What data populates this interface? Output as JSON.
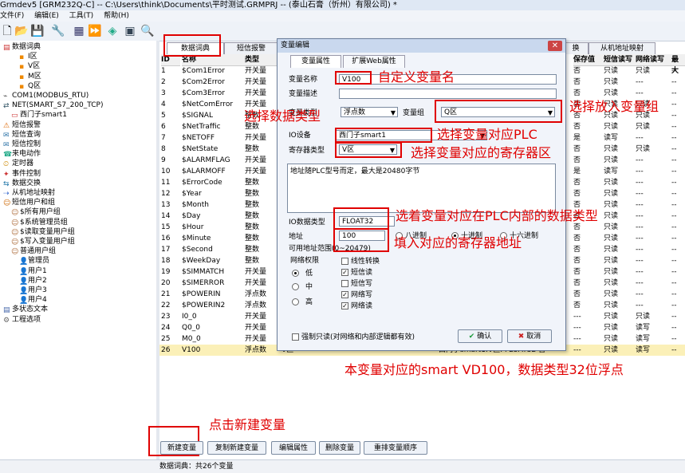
{
  "window": {
    "title": "Grmdev5 [GRM232Q-C] -- C:\\Users\\think\\Documents\\平时测试.GRMPRJ -- (泰山石膏（忻州）有限公司) *"
  },
  "menu": [
    "文件(F)",
    "编辑(E)",
    "工具(T)",
    "帮助(H)"
  ],
  "tree": [
    {
      "label": "数据词典",
      "indent": 0
    },
    {
      "label": "I区",
      "indent": 2
    },
    {
      "label": "V区",
      "indent": 2
    },
    {
      "label": "M区",
      "indent": 2
    },
    {
      "label": "Q区",
      "indent": 2
    },
    {
      "label": "COM1(MODBUS_RTU)",
      "indent": 0
    },
    {
      "label": "NET(SMART_S7_200_TCP)",
      "indent": 0
    },
    {
      "label": "西门子smart1",
      "indent": 1
    },
    {
      "label": "短信报警",
      "indent": 0
    },
    {
      "label": "短信查询",
      "indent": 0
    },
    {
      "label": "短信控制",
      "indent": 0
    },
    {
      "label": "来电动作",
      "indent": 0
    },
    {
      "label": "定时器",
      "indent": 0
    },
    {
      "label": "事件控制",
      "indent": 0
    },
    {
      "label": "数据交换",
      "indent": 0
    },
    {
      "label": "从机地址映射",
      "indent": 0
    },
    {
      "label": "短信用户和组",
      "indent": 0
    },
    {
      "label": "$所有用户组",
      "indent": 1
    },
    {
      "label": "$系统管理员组",
      "indent": 1
    },
    {
      "label": "$读取变量用户组",
      "indent": 1
    },
    {
      "label": "$写入变量用户组",
      "indent": 1
    },
    {
      "label": "普通用户组",
      "indent": 1
    },
    {
      "label": "管理员",
      "indent": 2
    },
    {
      "label": "用户1",
      "indent": 2
    },
    {
      "label": "用户2",
      "indent": 2
    },
    {
      "label": "用户3",
      "indent": 2
    },
    {
      "label": "用户4",
      "indent": 2
    },
    {
      "label": "多状态文本",
      "indent": 0
    },
    {
      "label": "工程选项",
      "indent": 0
    }
  ],
  "tabs": {
    "t1": "数据词典",
    "t2": "短信报警",
    "t3": "换",
    "t4": "从机地址映射"
  },
  "table": {
    "headers": [
      "ID",
      "名称",
      "类型",
      "保存值",
      "短信读写",
      "网络读写",
      "最大"
    ],
    "rows": [
      [
        "1",
        "$Com1Error",
        "开关量",
        "否",
        "只读",
        "只读",
        "--"
      ],
      [
        "2",
        "$Com2Error",
        "开关量",
        "否",
        "只读",
        "---",
        "--"
      ],
      [
        "3",
        "$Com3Error",
        "开关量",
        "否",
        "只读",
        "---",
        "--"
      ],
      [
        "4",
        "$NetComError",
        "开关量",
        "否",
        "只读",
        "只读",
        "--"
      ],
      [
        "5",
        "$SIGNAL",
        "整数",
        "否",
        "只读",
        "只读",
        "--"
      ],
      [
        "6",
        "$NetTraffic",
        "整数",
        "否",
        "只读",
        "只读",
        "--"
      ],
      [
        "7",
        "$NETOFF",
        "开关量",
        "是",
        "读写",
        "---",
        "--"
      ],
      [
        "8",
        "$NetState",
        "整数",
        "否",
        "只读",
        "只读",
        "--"
      ],
      [
        "9",
        "$ALARMFLAG",
        "开关量",
        "否",
        "只读",
        "---",
        "--"
      ],
      [
        "10",
        "$ALARMOFF",
        "开关量",
        "是",
        "读写",
        "---",
        "--"
      ],
      [
        "11",
        "$ErrorCode",
        "整数",
        "否",
        "只读",
        "---",
        "--"
      ],
      [
        "12",
        "$Year",
        "整数",
        "否",
        "只读",
        "---",
        "--"
      ],
      [
        "13",
        "$Month",
        "整数",
        "否",
        "只读",
        "---",
        "--"
      ],
      [
        "14",
        "$Day",
        "整数",
        "否",
        "只读",
        "---",
        "--"
      ],
      [
        "15",
        "$Hour",
        "整数",
        "否",
        "只读",
        "---",
        "--"
      ],
      [
        "16",
        "$Minute",
        "整数",
        "否",
        "只读",
        "---",
        "--"
      ],
      [
        "17",
        "$Second",
        "整数",
        "否",
        "只读",
        "---",
        "--"
      ],
      [
        "18",
        "$WeekDay",
        "整数",
        "否",
        "只读",
        "---",
        "--"
      ],
      [
        "19",
        "$SIMMATCH",
        "开关量",
        "否",
        "只读",
        "---",
        "--"
      ],
      [
        "20",
        "$SIMERROR",
        "开关量",
        "否",
        "只读",
        "---",
        "--"
      ],
      [
        "21",
        "$POWERIN",
        "浮点数",
        "否",
        "只读",
        "---",
        "--"
      ],
      [
        "22",
        "$POWERIN2",
        "浮点数",
        "否",
        "只读",
        "---",
        "--"
      ],
      [
        "23",
        "I0_0",
        "开关量",
        "---",
        "只读",
        "只读",
        "--"
      ],
      [
        "24",
        "Q0_0",
        "开关量",
        "---",
        "只读",
        "读写",
        "--"
      ],
      [
        "25",
        "M0_0",
        "开关量",
        "---",
        "只读",
        "读写",
        "--"
      ],
      [
        "26",
        "V100",
        "浮点数",
        "---",
        "只读",
        "读写",
        "--"
      ]
    ],
    "row26_extra": {
      "zone": "V区",
      "device": "西门子smart1:V区:  FLOAT32  否"
    }
  },
  "dialog": {
    "title": "变量编辑",
    "close": "✕",
    "tab1": "变量属性",
    "tab2": "扩展Web属性",
    "name_label": "变量名称",
    "name_value": "V100",
    "desc_label": "变量描述",
    "type_label": "变量类型",
    "type_value": "浮点数",
    "group_label": "变量组",
    "group_value": "Q区",
    "io_label": "IO设备",
    "io_value": "西门子smart1",
    "reg_label": "寄存器类型",
    "reg_value": "V区",
    "info_text": "地址随PLC型号而定，最大是20480字节",
    "iotype_label": "IO数据类型",
    "iotype_value": "FLOAT32",
    "addr_label": "地址",
    "addr_value": "100",
    "radix_oct": "八进制",
    "radix_dec": "十进制",
    "radix_hex": "十六进制",
    "range_label": "可用地址范围(0~20479)",
    "net_perm_label": "网络权限",
    "perm_low": "低",
    "perm_mid": "中",
    "perm_high": "高",
    "opt_linear": "线性转换",
    "opt_sms_read": "短信读",
    "opt_sms_write": "短信写",
    "opt_net_write": "网络写",
    "opt_net_read": "网络读",
    "force_ro": "强制只读(对网络和内部逻辑都有效)",
    "ok": "确认",
    "cancel": "取消"
  },
  "annotations": {
    "a1": "自定义变量名",
    "a2": "选择数据类型",
    "a3": "选择放入变量组",
    "a4": "选择变量对应PLC",
    "a5": "选择变量对应的寄存器区",
    "a6": "选着变量对应在PLC内部的数据类型",
    "a7": "填入对应的寄存器地址",
    "a8": "本变量对应的smart VD100，数据类型32位浮点",
    "a9": "点击新建变量"
  },
  "bottom_buttons": {
    "new": "新建变量",
    "copy": "复制新建变量",
    "edit": "编辑属性",
    "del": "删除变量",
    "reorder": "重排变量顺序"
  },
  "status": "数据词典：共26个变量"
}
